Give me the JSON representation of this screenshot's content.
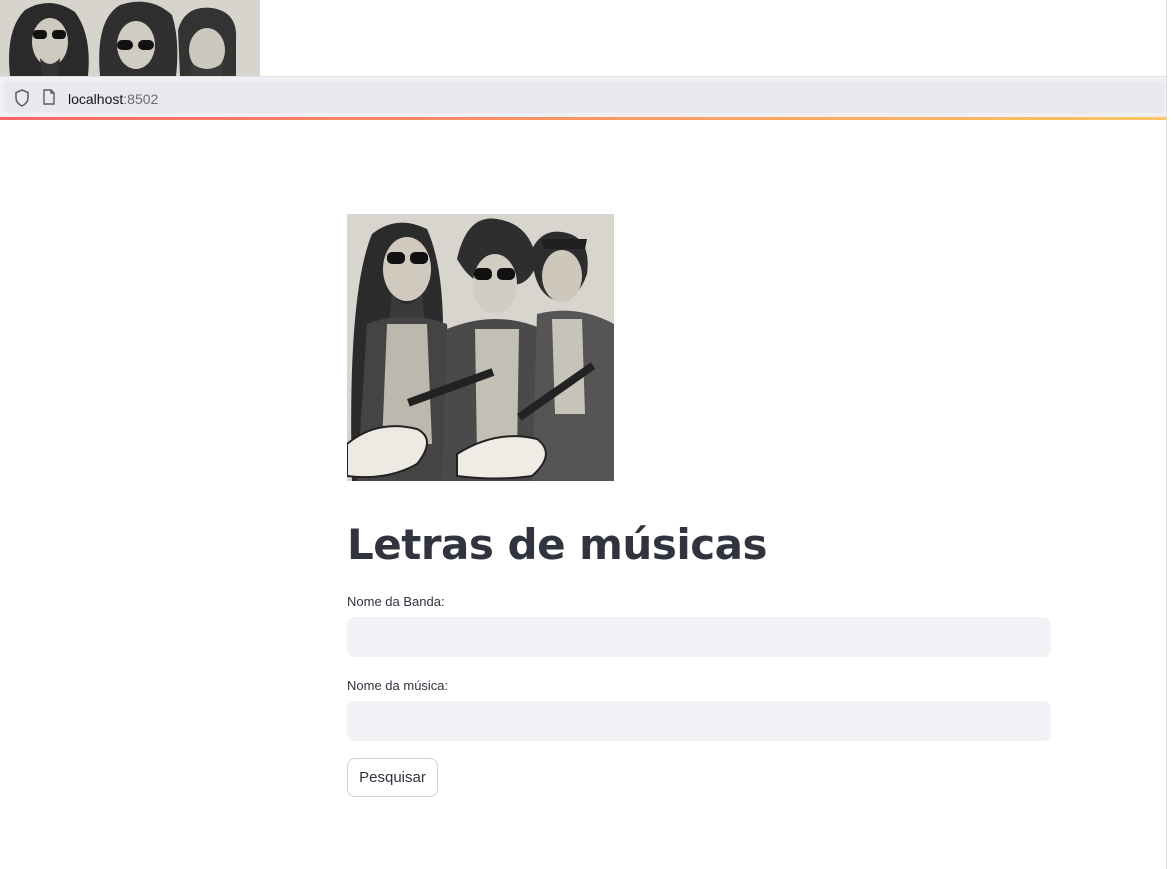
{
  "browser": {
    "url_host": "localhost",
    "url_port": ":8502"
  },
  "app": {
    "title": "Letras de músicas",
    "band_label": "Nome da Banda:",
    "band_value": "",
    "song_label": "Nome da música:",
    "song_value": "",
    "search_button": "Pesquisar"
  },
  "colors": {
    "accent_start": "#ff4b4b",
    "accent_end": "#ffbd45",
    "input_bg": "#f0f2f6",
    "text": "#31333f"
  }
}
